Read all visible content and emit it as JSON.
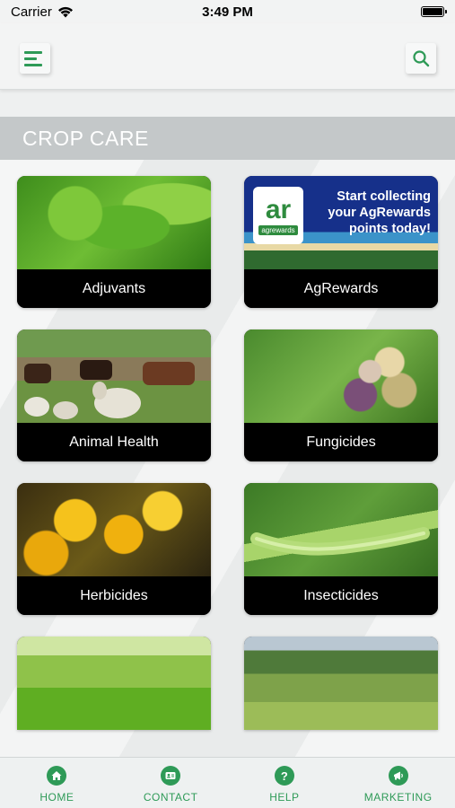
{
  "status_bar": {
    "carrier": "Carrier",
    "time": "3:49 PM"
  },
  "nav": {
    "menu_icon": "hamburger-menu-icon",
    "search_icon": "search-icon"
  },
  "section": {
    "title": "CROP CARE"
  },
  "tiles": [
    {
      "label": "Adjuvants"
    },
    {
      "label": "AgRewards",
      "banner_text": "Start collecting your AgRewards points today!",
      "logo_mark": "ar",
      "logo_caption": "agrewards"
    },
    {
      "label": "Animal Health"
    },
    {
      "label": "Fungicides"
    },
    {
      "label": "Herbicides"
    },
    {
      "label": "Insecticides"
    },
    {
      "label": ""
    },
    {
      "label": ""
    }
  ],
  "tab_bar": {
    "items": [
      {
        "label": "HOME",
        "icon": "home-icon"
      },
      {
        "label": "CONTACT",
        "icon": "contact-card-icon"
      },
      {
        "label": "HELP",
        "icon": "help-icon"
      },
      {
        "label": "MARKETING",
        "icon": "megaphone-icon"
      }
    ]
  },
  "colors": {
    "accent": "#2e9a57",
    "section_header_bg": "#c4c8c9"
  }
}
